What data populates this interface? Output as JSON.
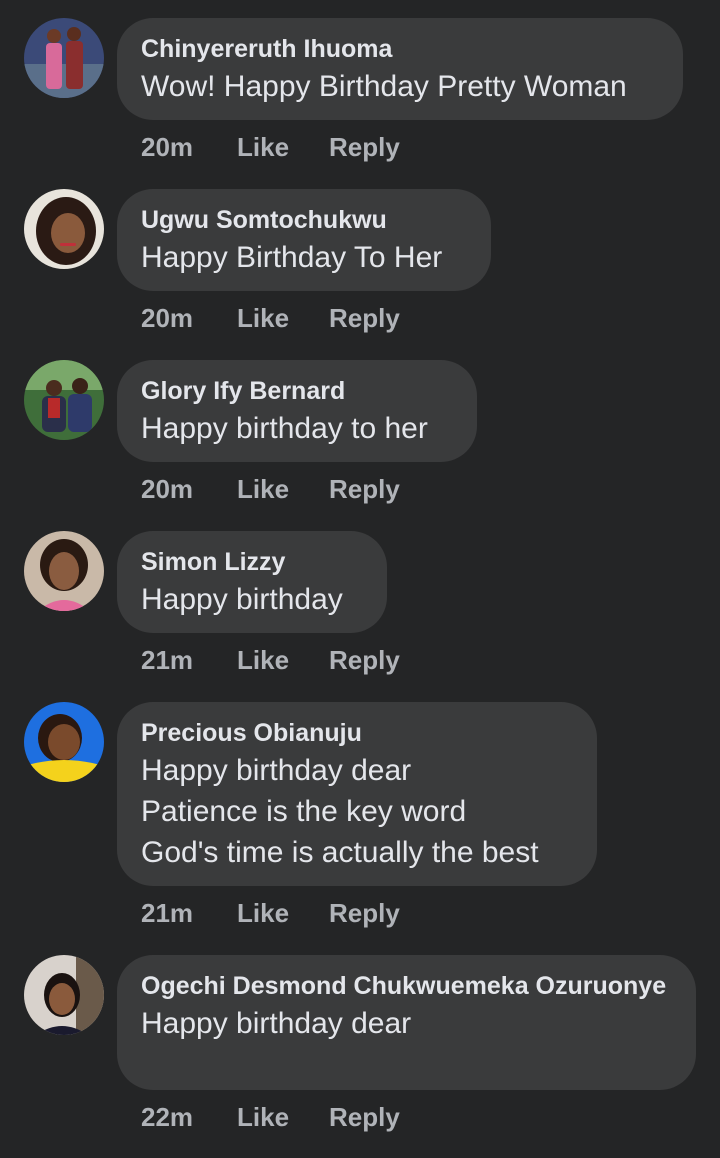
{
  "comments": [
    {
      "author": "Chinyereruth Ihuoma",
      "lines": [
        "Wow! Happy Birthday Pretty Woman"
      ],
      "time": "20m",
      "like_label": "Like",
      "reply_label": "Reply",
      "avatar": {
        "bg": "#3b4a78",
        "accent": "#d86a9a"
      }
    },
    {
      "author": "Ugwu Somtochukwu",
      "lines": [
        "Happy Birthday To Her"
      ],
      "time": "20m",
      "like_label": "Like",
      "reply_label": "Reply",
      "avatar": {
        "bg": "#e8e4dc",
        "accent": "#2a1a14"
      }
    },
    {
      "author": "Glory Ify Bernard",
      "lines": [
        "Happy birthday to her"
      ],
      "time": "20m",
      "like_label": "Like",
      "reply_label": "Reply",
      "avatar": {
        "bg": "#3f6e3a",
        "accent": "#b82a2a"
      }
    },
    {
      "author": "Simon Lizzy",
      "lines": [
        "Happy birthday"
      ],
      "time": "21m",
      "like_label": "Like",
      "reply_label": "Reply",
      "avatar": {
        "bg": "#c9b9a8",
        "accent": "#e46a9c"
      }
    },
    {
      "author": "Precious Obianuju",
      "lines": [
        "Happy birthday dear",
        "Patience is the key word",
        "God's time is actually the best"
      ],
      "time": "21m",
      "like_label": "Like",
      "reply_label": "Reply",
      "avatar": {
        "bg": "#1e6fe0",
        "accent": "#f4d21c"
      }
    },
    {
      "author": "Ogechi Desmond Chukwuemeka Ozuruonye",
      "lines": [
        "Happy birthday dear"
      ],
      "time": "22m",
      "like_label": "Like",
      "reply_label": "Reply",
      "avatar": {
        "bg": "#d8d2cc",
        "accent": "#1a1a2e"
      }
    }
  ]
}
